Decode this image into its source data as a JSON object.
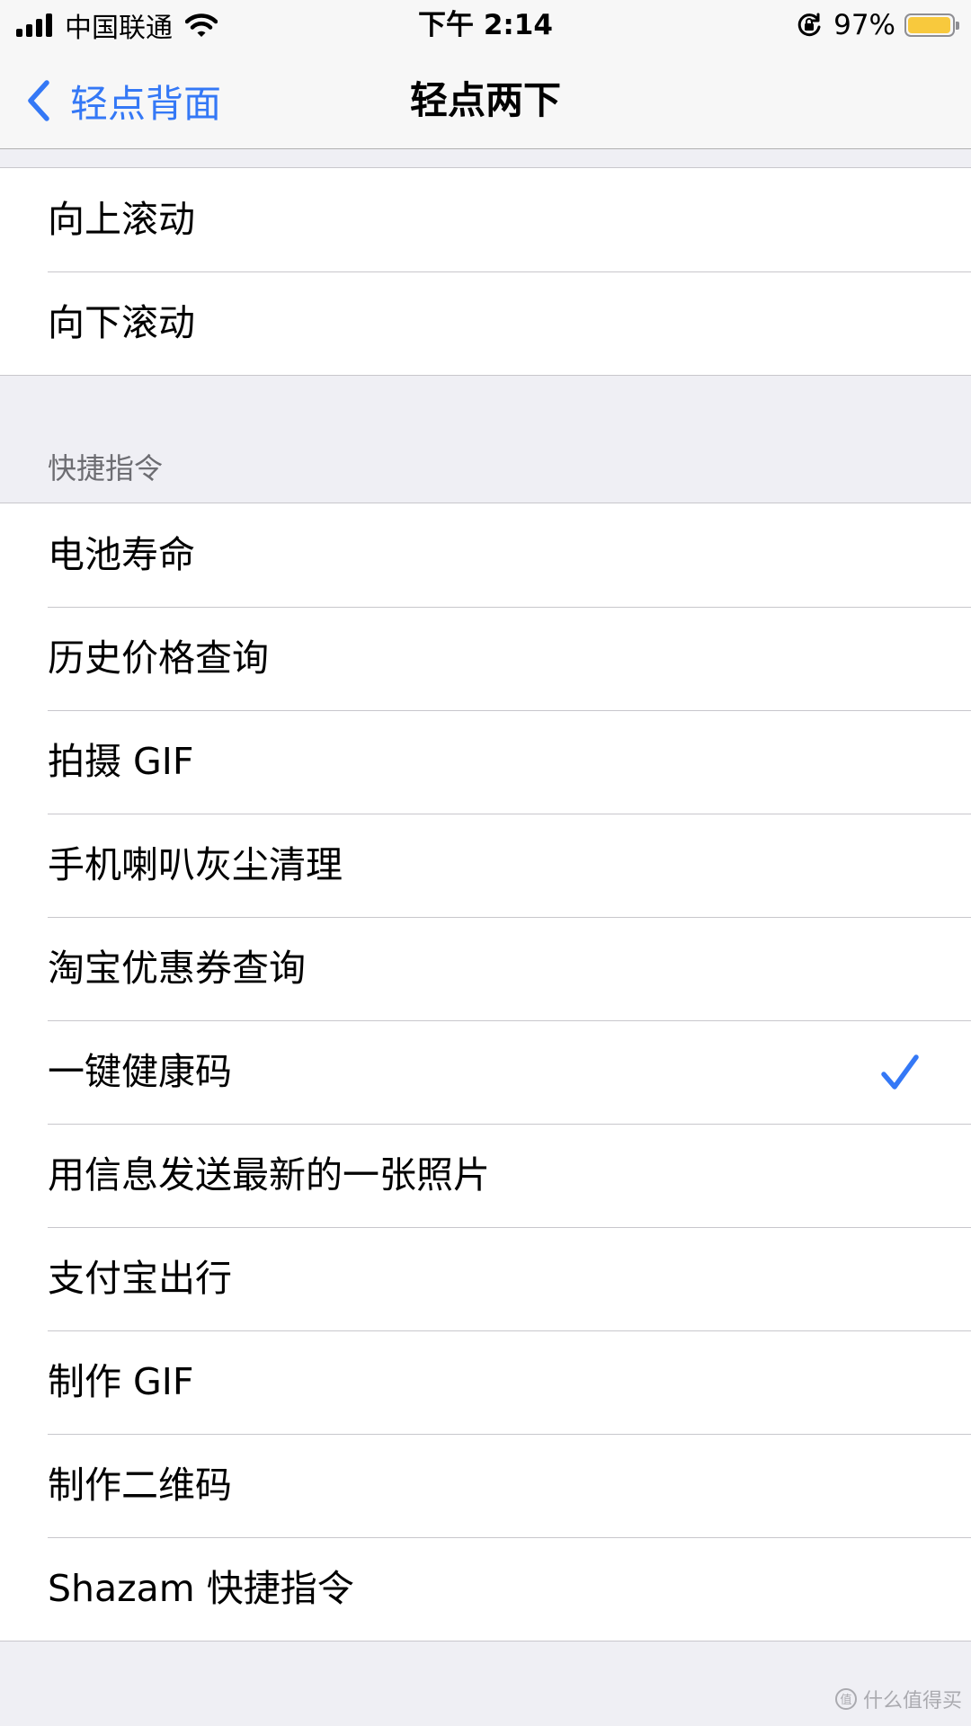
{
  "status_bar": {
    "carrier": "中国联通",
    "time": "下午 2:14",
    "battery_percent": "97%",
    "battery_level": 0.97,
    "battery_color": "#f8c93d"
  },
  "nav": {
    "back_label": "轻点背面",
    "title": "轻点两下",
    "accent_color": "#3478f6"
  },
  "top_group": {
    "items": [
      {
        "label": "向上滚动"
      },
      {
        "label": "向下滚动"
      }
    ]
  },
  "shortcuts_section": {
    "header": "快捷指令",
    "selected": "一键健康码",
    "items": [
      {
        "label": "电池寿命"
      },
      {
        "label": "历史价格查询"
      },
      {
        "label": "拍摄 GIF"
      },
      {
        "label": "手机喇叭灰尘清理"
      },
      {
        "label": "淘宝优惠券查询"
      },
      {
        "label": "一键健康码"
      },
      {
        "label": "用信息发送最新的一张照片"
      },
      {
        "label": "支付宝出行"
      },
      {
        "label": "制作 GIF"
      },
      {
        "label": "制作二维码"
      },
      {
        "label": "Shazam 快捷指令"
      }
    ]
  },
  "watermark": {
    "text": "什么值得买"
  }
}
